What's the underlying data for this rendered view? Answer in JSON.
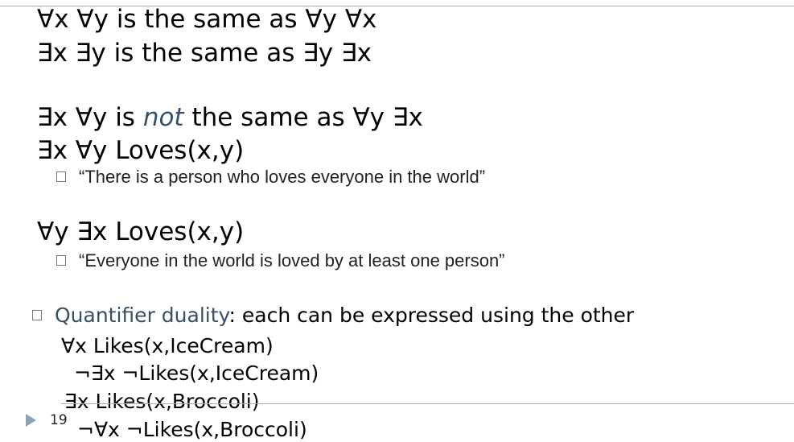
{
  "slide": {
    "line1": "∀x ∀y is the same as ∀y ∀x",
    "line2": "∃x ∃y is the same as ∃y ∃x",
    "line3": {
      "pre": "∃x ∀y is ",
      "emph": "not",
      "post": " the same as ∀y ∃x"
    },
    "line4": "∃x ∀y Loves(x,y)",
    "sub1": "“There is a person who loves everyone in the world”",
    "line5": "∀y ∃x Loves(x,y)",
    "sub2": "“Everyone in the world is loved by at least one person”",
    "duality": {
      "label": "Quantifier duality",
      "rest": ": each can be expressed using the other"
    },
    "formulas": [
      "∀x Likes(x,IceCream)",
      "¬∃x ¬Likes(x,IceCream)",
      "∃x Likes(x,Broccoli)",
      "¬∀x ¬Likes(x,Broccoli)"
    ],
    "page_number": "19"
  },
  "colors": {
    "accent": "#34506a",
    "rule": "#9fb0bc",
    "triangle": "#8da3b5"
  }
}
